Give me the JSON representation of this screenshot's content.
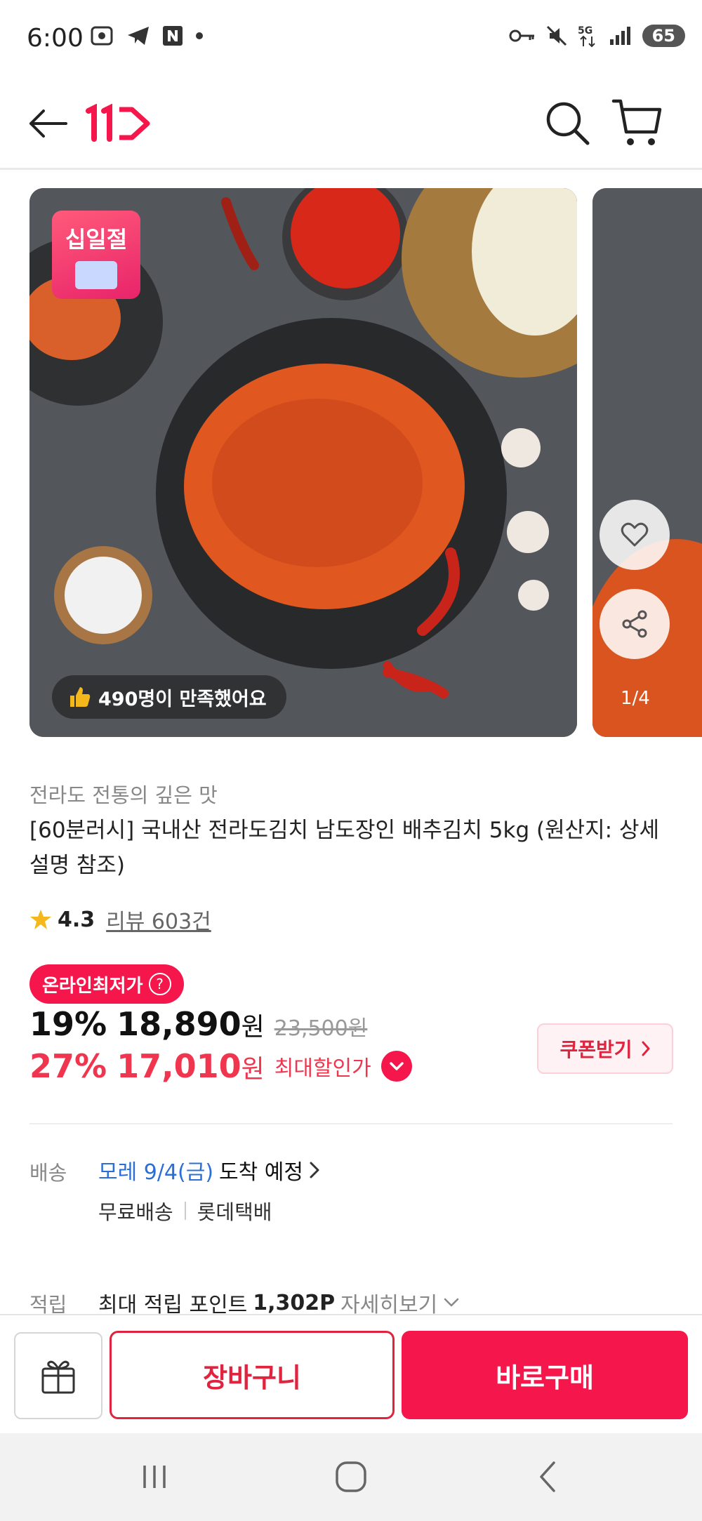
{
  "status_bar": {
    "time": "6:00",
    "battery": "65"
  },
  "header": {
    "logo_text": "11",
    "brand_color": "#f5164b"
  },
  "gallery": {
    "badge_label": "십일절",
    "satisfied_text": "490명이 만족했어요",
    "page_indicator": "1/4"
  },
  "product": {
    "subtitle": "전라도 전통의 깊은 맛",
    "title": "[60분러시] 국내산 전라도김치 남도장인 배추김치 5kg (원산지: 상세설명 참조)",
    "rating": "4.3",
    "review_text": "리뷰 603건"
  },
  "price": {
    "lowest_badge": "온라인최저가",
    "discount_pct": "19%",
    "sale_price": "18,890",
    "currency": "원",
    "original_price": "23,500원",
    "max_discount_pct": "27%",
    "max_price": "17,010",
    "max_discount_label": "최대할인가",
    "coupon_label": "쿠폰받기",
    "accent_color": "#f0364f"
  },
  "shipping": {
    "label": "배송",
    "date": "모레 9/4(금)",
    "arrival": "도착 예정",
    "free_shipping": "무료배송",
    "carrier": "롯데택배"
  },
  "points": {
    "label": "적립",
    "text": "최대 적립 포인트",
    "value": "1,302P",
    "more": "자세히보기"
  },
  "bottom_bar": {
    "cart_label": "장바구니",
    "buy_label": "바로구매"
  }
}
